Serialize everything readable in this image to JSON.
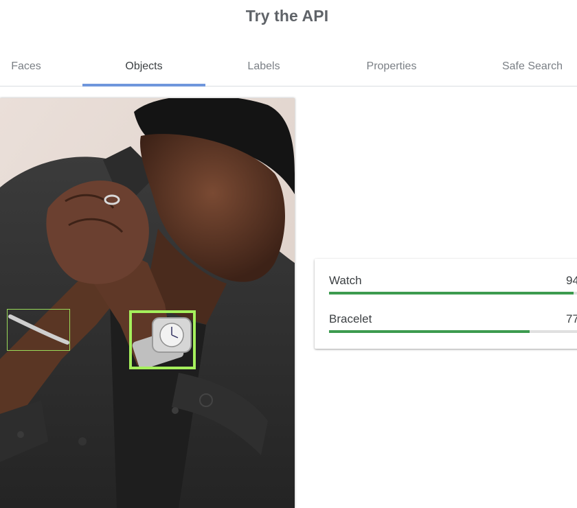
{
  "header": {
    "title": "Try the API"
  },
  "tabs": [
    {
      "label": "Faces",
      "active": false
    },
    {
      "label": "Objects",
      "active": true
    },
    {
      "label": "Labels",
      "active": false
    },
    {
      "label": "Properties",
      "active": false
    },
    {
      "label": "Safe Search",
      "active": false
    }
  ],
  "detections": [
    {
      "label": "Watch",
      "score_text": "94",
      "score": 0.94
    },
    {
      "label": "Bracelet",
      "score_text": "77",
      "score": 0.77
    }
  ],
  "colors": {
    "accent_tab": "#6f96dc",
    "bar_fill": "#3d9b4f",
    "bar_track": "#e0e0e0",
    "box_highlight": "#a5f05c"
  }
}
